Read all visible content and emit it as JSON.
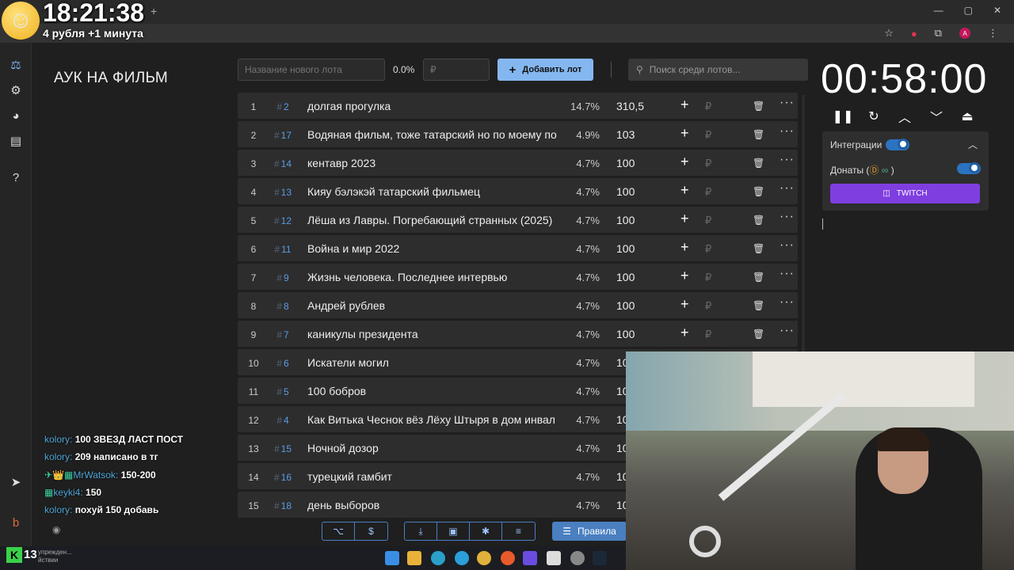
{
  "overlay": {
    "clock": "18:21:38",
    "subtitle": "4 рубля +1 минута"
  },
  "app": {
    "title": "АУК НА ФИЛЬМ"
  },
  "toolbar": {
    "lot_placeholder": "Название нового лота",
    "percent": "0.0%",
    "currency_placeholder": "₽",
    "add_label": "Добавить лот",
    "search_placeholder": "Поиск среди лотов..."
  },
  "lots": [
    {
      "num": "1",
      "id": "2",
      "name": "долгая прогулка",
      "pct": "14.7%",
      "amount": "310,5"
    },
    {
      "num": "2",
      "id": "17",
      "name": "Водяная фильм, тоже татарский но по моему по",
      "pct": "4.9%",
      "amount": "103"
    },
    {
      "num": "3",
      "id": "14",
      "name": "кентавр 2023",
      "pct": "4.7%",
      "amount": "100"
    },
    {
      "num": "4",
      "id": "13",
      "name": "Кияу бэлэкэй татарский фильмец",
      "pct": "4.7%",
      "amount": "100"
    },
    {
      "num": "5",
      "id": "12",
      "name": "Лёша из Лавры. Погребающий странных (2025)",
      "pct": "4.7%",
      "amount": "100"
    },
    {
      "num": "6",
      "id": "11",
      "name": "Война и мир 2022",
      "pct": "4.7%",
      "amount": "100"
    },
    {
      "num": "7",
      "id": "9",
      "name": "Жизнь человека. Последнее интервью",
      "pct": "4.7%",
      "amount": "100"
    },
    {
      "num": "8",
      "id": "8",
      "name": "Андрей рублев",
      "pct": "4.7%",
      "amount": "100"
    },
    {
      "num": "9",
      "id": "7",
      "name": "каникулы президента",
      "pct": "4.7%",
      "amount": "100"
    },
    {
      "num": "10",
      "id": "6",
      "name": "Искатели могил",
      "pct": "4.7%",
      "amount": "10"
    },
    {
      "num": "11",
      "id": "5",
      "name": "100 бобров",
      "pct": "4.7%",
      "amount": "10"
    },
    {
      "num": "12",
      "id": "4",
      "name": "Как Витька Чеснок вёз Лёху Штыря в дом инвал",
      "pct": "4.7%",
      "amount": "10"
    },
    {
      "num": "13",
      "id": "15",
      "name": "Ночной дозор",
      "pct": "4.7%",
      "amount": "10"
    },
    {
      "num": "14",
      "id": "16",
      "name": "турецкий гамбит",
      "pct": "4.7%",
      "amount": "10"
    },
    {
      "num": "15",
      "id": "18",
      "name": "день выборов",
      "pct": "4.7%",
      "amount": "10"
    }
  ],
  "timer": {
    "value": "00:58:00"
  },
  "integrations": {
    "label": "Интеграции",
    "donations_label": "Донаты (",
    "donations_close": ")",
    "twitch_label": "TWITCH"
  },
  "bottom": {
    "rules_label": "Правила"
  },
  "chat": [
    {
      "nick": "kolory:",
      "msg": "100 ЗВЕЗД ЛАСТ ПОСТ",
      "badges": ""
    },
    {
      "nick": "kolory:",
      "msg": "209 написано в тг",
      "badges": ""
    },
    {
      "nick": "MrWatsok:",
      "msg": "150-200",
      "badges": "✈👑▦"
    },
    {
      "nick": "keyki4:",
      "msg": "150",
      "badges": "▦"
    },
    {
      "nick": "kolory:",
      "msg": "похуй 150 добавь",
      "badges": ""
    }
  ],
  "taskbar": {
    "k_count": "13",
    "warning_line1": "упрежден...",
    "warning_line2": "йствии"
  },
  "colors": {
    "accent": "#84b7ef",
    "twitch": "#7f3ee0",
    "id_link": "#5a9be8",
    "background": "#1f1f1f"
  }
}
